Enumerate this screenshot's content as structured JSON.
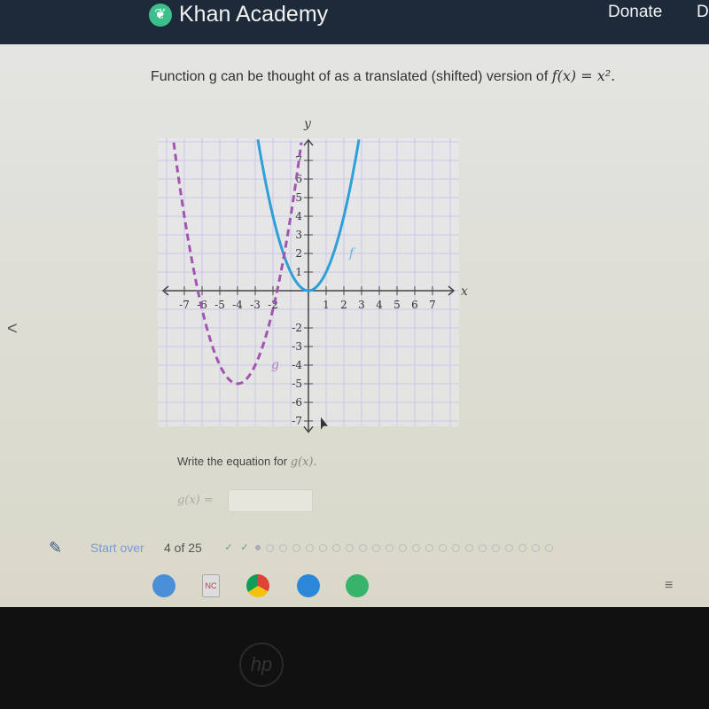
{
  "header": {
    "brand": "Khan Academy",
    "donate": "Donate",
    "more": "D"
  },
  "prompt": {
    "text": "Function g can be thought of as a translated (shifted) version of",
    "formula": "f(x) = x²."
  },
  "chart_data": {
    "type": "line",
    "xlabel": "x",
    "ylabel": "y",
    "xlim": [
      -8.5,
      8.5
    ],
    "ylim": [
      -7.5,
      8.2
    ],
    "xticks": [
      -7,
      -6,
      -5,
      -4,
      -3,
      -2,
      1,
      2,
      3,
      4,
      5,
      6,
      7
    ],
    "yticks": [
      -7,
      -6,
      -5,
      -4,
      -3,
      -2,
      1,
      2,
      3,
      4,
      5,
      6,
      7
    ],
    "grid": true,
    "series": [
      {
        "name": "f",
        "equation": "x^2",
        "vertex": [
          0,
          0
        ],
        "style": "solid",
        "color": "#2e9fd8"
      },
      {
        "name": "g",
        "vertex": [
          -4,
          -5
        ],
        "style": "dashed",
        "color": "#a255b0"
      }
    ]
  },
  "question": {
    "text": "Write the equation for",
    "fn": "g(x).",
    "label": "g(x) =",
    "answer_value": ""
  },
  "footer": {
    "start_over": "Start over",
    "count": "4 of 25",
    "completed": 2,
    "current": 3,
    "total": 25
  },
  "nav": {
    "back": "<"
  },
  "shelf": {
    "apps": [
      "zoom",
      "notes",
      "chrome",
      "camera",
      "spotify"
    ],
    "right": "≡"
  },
  "device": {
    "logo": "hp"
  }
}
